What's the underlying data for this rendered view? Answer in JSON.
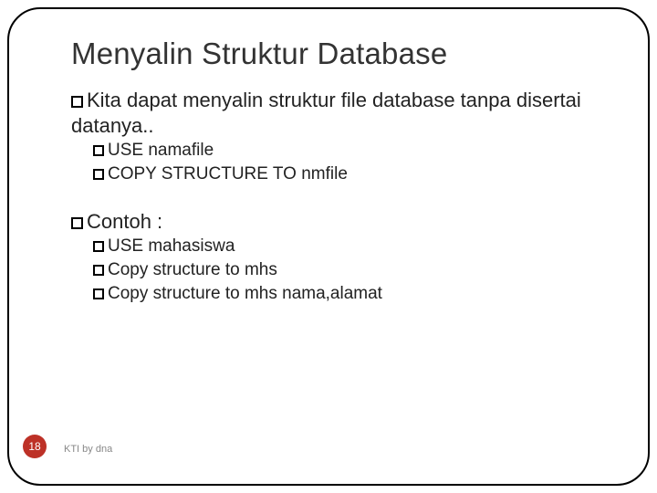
{
  "slide": {
    "title": "Menyalin Struktur Database",
    "bullets": [
      {
        "level": 1,
        "text": "Kita dapat menyalin struktur file database tanpa disertai datanya.."
      },
      {
        "level": 2,
        "text": "USE namafile"
      },
      {
        "level": 2,
        "text": "COPY STRUCTURE TO nmfile"
      },
      {
        "level": 0,
        "text": ""
      },
      {
        "level": 1,
        "text": "Contoh :"
      },
      {
        "level": 2,
        "text": "USE mahasiswa"
      },
      {
        "level": 2,
        "text": "Copy structure to mhs"
      },
      {
        "level": 2,
        "text": "Copy structure to mhs nama,alamat"
      }
    ],
    "page_number": "18",
    "footer": "KTI by dna"
  }
}
